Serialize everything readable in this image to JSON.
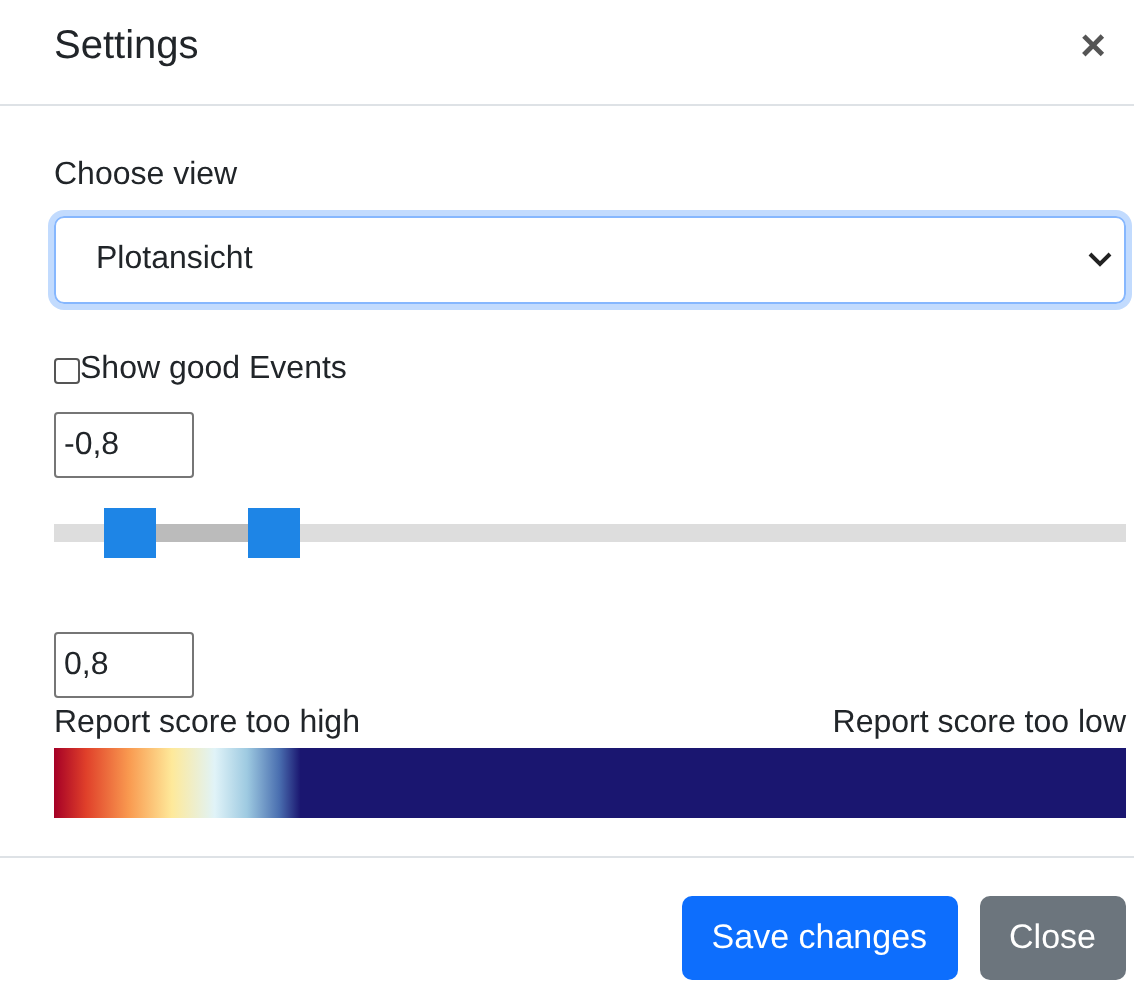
{
  "window": {
    "title": "Settings",
    "close": "×"
  },
  "view": {
    "label": "Choose view",
    "value": "Plotansicht"
  },
  "show_good_events": {
    "label": "Show good Events",
    "checked": false
  },
  "range": {
    "min_value": "-0,8",
    "max_value": "0,8",
    "low": {
      "level": 0.07
    },
    "high": {
      "level": 0.205
    }
  },
  "legend": {
    "left": "Report score too high",
    "right": "Report score too low"
  },
  "buttons": [
    {
      "label": "Save changes",
      "kind": "primary"
    },
    {
      "label": "Close",
      "kind": "secondary"
    }
  ]
}
